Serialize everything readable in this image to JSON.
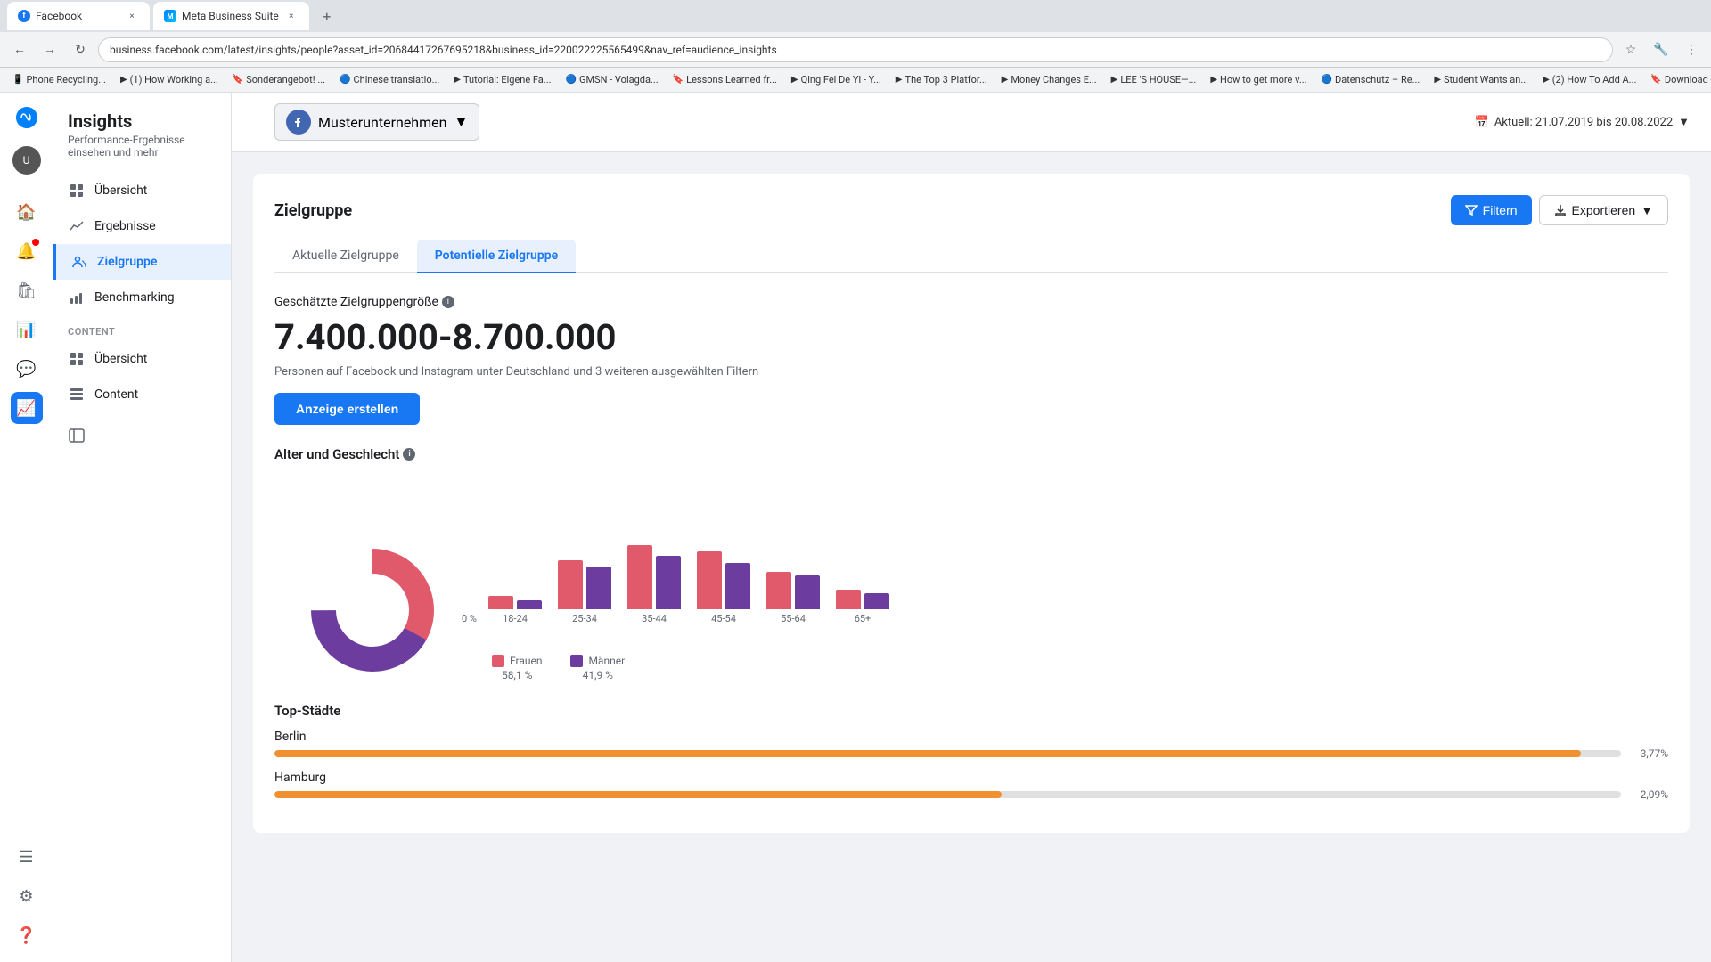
{
  "browser": {
    "tabs": [
      {
        "id": "tab1",
        "label": "Facebook",
        "active": false,
        "favicon_color": "#1877f2"
      },
      {
        "id": "tab2",
        "label": "Meta Business Suite",
        "active": true,
        "favicon_color": "#0080ff"
      }
    ],
    "address": "business.facebook.com/latest/insights/people?asset_id=20684417267695218&business_id=220022225565499&nav_ref=audience_insights",
    "bookmarks": [
      "Phone Recycling...",
      "(1) How Working a...",
      "Sonderangebot! ...",
      "Chinese translatio...",
      "Tutorial: Eigene Fa...",
      "GMSN - Volagda...",
      "Lessons Learned fr...",
      "Qing Fei De Yi - Y...",
      "The Top 3 Platfor...",
      "Money Changes E...",
      "LEE 'S HOUSE—...",
      "How to get more v...",
      "Datenschutz – Re...",
      "Student Wants an...",
      "(2) How To Add A...",
      "Download - Cook..."
    ]
  },
  "header": {
    "app_title": "Insights",
    "app_subtitle": "Performance-Ergebnisse einsehen und mehr",
    "business_name": "Musterunternehmen",
    "date_range": "Aktuell: 21.07.2019 bis 20.08.2022"
  },
  "nav": {
    "items": [
      {
        "id": "ubersicht",
        "label": "Übersicht",
        "icon": "grid"
      },
      {
        "id": "ergebnisse",
        "label": "Ergebnisse",
        "icon": "chart-line"
      },
      {
        "id": "zielgruppe",
        "label": "Zielgruppe",
        "icon": "users",
        "active": true
      },
      {
        "id": "benchmarking",
        "label": "Benchmarking",
        "icon": "bar-chart"
      }
    ],
    "content_section": "Content",
    "content_items": [
      {
        "id": "content-ubersicht",
        "label": "Übersicht",
        "icon": "grid"
      },
      {
        "id": "content-content",
        "label": "Content",
        "icon": "table"
      }
    ]
  },
  "page": {
    "title": "Zielgruppe",
    "filter_label": "Filtern",
    "export_label": "Exportieren",
    "tabs": [
      {
        "id": "aktuelle",
        "label": "Aktuelle Zielgruppe",
        "active": false
      },
      {
        "id": "potenzielle",
        "label": "Potentielle Zielgruppe",
        "active": true
      }
    ],
    "estimated_label": "Geschätzte Zielgruppengröße",
    "estimated_value": "7.400.000-8.700.000",
    "estimated_desc": "Personen auf Facebook und Instagram unter Deutschland und 3 weiteren ausgewählten Filtern",
    "create_ad_label": "Anzeige erstellen",
    "age_gender_title": "Alter und Geschlecht",
    "chart": {
      "y_label": "0 %",
      "age_groups": [
        "18-24",
        "25-34",
        "35-44",
        "45-54",
        "55-64",
        "65+"
      ],
      "frauen_heights": [
        15,
        55,
        72,
        65,
        42,
        22
      ],
      "maenner_heights": [
        10,
        48,
        60,
        52,
        38,
        18
      ],
      "legend_frauen": "Frauen",
      "legend_frauen_pct": "58,1 %",
      "legend_maenner": "Männer",
      "legend_maenner_pct": "41,9 %",
      "donut": {
        "frauen_pct": 58.1,
        "maenner_pct": 41.9
      }
    },
    "top_cities_title": "Top-Städte",
    "cities": [
      {
        "name": "Berlin",
        "pct": "3,77%",
        "fill_pct": 97
      },
      {
        "name": "Hamburg",
        "pct": "2,09%",
        "fill_pct": 54
      }
    ]
  },
  "sidebar_icons": {
    "home": "🏠",
    "bell": "🔔",
    "store": "🛍",
    "chart": "📊",
    "comment": "💬",
    "insights": "📈",
    "menu": "☰",
    "settings": "⚙",
    "help": "❓",
    "sidebar_toggle": "⊟"
  }
}
